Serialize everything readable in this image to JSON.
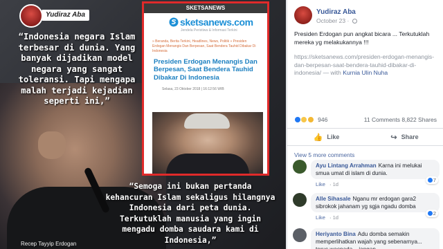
{
  "meme": {
    "brand_label": "Yudiraz Aba",
    "quote_top": "“Indonesia negara Islam terbesar di dunia. Yang banyak dijadikan model negara yang sangat toleransi. Tapi mengapa malah terjadi kejadian seperti ini,”",
    "quote_bottom": "“Semoga ini bukan pertanda kehancuran Islam sekaligus hilangnya Indonesia dari peta dunia. Terkutuklah manusia yang ingin mengadu domba saudara kami di Indonesia,”",
    "caption": "Recep Tayyip Erdogan",
    "news_card": {
      "topbar": "SKETSANEWS",
      "logo": "sketsanews.com",
      "tagline": "Jendela Peristiwa & Informasi Terkini",
      "breadcrumbs": "» Beranda, Berita Terkini, Headlines, News, Politik » Presiden Erdogan Menangis Dan Berpesan, Saat Bendera Tauhid Dibakar Di Indonesia",
      "title": "Presiden Erdogan Menangis Dan Berpesan, Saat Bendera Tauhid Dibakar Di Indonesia",
      "date": "Selasa, 23 Oktober 2018 | 16:12:56 WIB"
    }
  },
  "post": {
    "author": "Yudiraz Aba",
    "timestamp": "October 23",
    "text_line1": "Presiden Erdogan pun angkat bicara ... Terkutuklah mereka yg melakukannya !!!",
    "link": "https://sketsanews.com/presiden-erdogan-menangis-dan-berpesan-saat-bendera-tauhid-dibakar-di-indonesia/",
    "link_suffix": " — with ",
    "tagged": "Kurnia Ulin Nuha",
    "reaction_count": "946",
    "comments_count": "11 Comments",
    "shares_count": "8,822 Shares",
    "actions": {
      "like": "Like",
      "share": "Share"
    },
    "view_more": "View 5 more comments"
  },
  "comments": [
    {
      "name": "Ayu Lintang Arrahman",
      "text": "Karna ini melukai smua umat di islam di dunia.",
      "like": "Like",
      "time": "1d",
      "likes": "7",
      "avatar_color": "#3a5a2c"
    },
    {
      "name": "Alle Sihasale",
      "text": "Nganu mr erdogan gara2 sibrokok jahanam yg sgja ngadu domba",
      "like": "Like",
      "time": "1d",
      "likes": "2",
      "avatar_color": "#2f3b2a"
    },
    {
      "name": "Heriyanto Bina",
      "text": "Adu domba semakin memperlihatkan wajah yang sebenarnya... terus waspada... jangan",
      "like": "",
      "time": "",
      "likes": "",
      "avatar_color": "#5b5f66"
    }
  ]
}
